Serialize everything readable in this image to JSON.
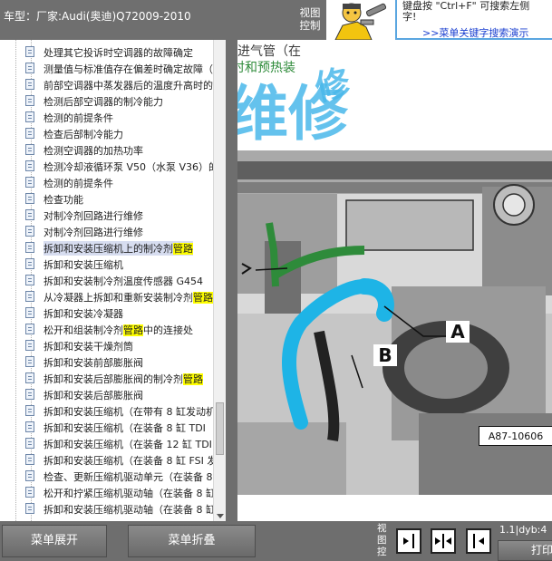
{
  "title_bar": {
    "title": "车型：厂家:Audi(奥迪)Q72009-2010",
    "view_control": "视图控制"
  },
  "banner": {
    "tip_line1": "键盘按 \"Ctrl+F\" 可搜索左侧",
    "tip_line2": "字!",
    "tip_link": ">>菜单关键字搜索演示"
  },
  "tree": {
    "items": [
      {
        "label": "处理其它投诉时空调器的故障确定"
      },
      {
        "label": "测量值与标准值存在偏差时确定故障（"
      },
      {
        "label": "前部空调器中蒸发器后的温度升高时的"
      },
      {
        "label": "检测后部空调器的制冷能力"
      },
      {
        "label": "检测的前提条件"
      },
      {
        "label": "检查后部制冷能力"
      },
      {
        "label": "检测空调器的加热功率"
      },
      {
        "label": "检测冷却液循环泵 V50（水泵 V36）的"
      },
      {
        "label": "检测的前提条件"
      },
      {
        "label": "检查功能"
      },
      {
        "label": "对制冷剂回路进行维修"
      },
      {
        "label": "对制冷剂回路进行维修"
      },
      {
        "label": "拆卸和安装压缩机上的制冷剂",
        "highlight": "管路",
        "selected": true
      },
      {
        "label": "拆卸和安装压缩机"
      },
      {
        "label": "拆卸和安装制冷剂温度传感器 G454"
      },
      {
        "label": "从冷凝器上拆卸和重新安装制冷剂",
        "highlight": "管路"
      },
      {
        "label": "拆卸和安装冷凝器"
      },
      {
        "label": "松开和组装制冷剂",
        "highlight": "管路",
        "suffix": "中的连接处"
      },
      {
        "label": "拆卸和安装干燥剂筒"
      },
      {
        "label": "拆卸和安装前部膨胀阀"
      },
      {
        "label": "拆卸和安装后部膨胀阀的制冷剂",
        "highlight": "管路"
      },
      {
        "label": "拆卸和安装后部膨胀阀"
      },
      {
        "label": "拆卸和安装压缩机（在带有 8 缸发动机"
      },
      {
        "label": "拆卸和安装压缩机（在装备 8 缸 TDI"
      },
      {
        "label": "拆卸和安装压缩机（在装备 12 缸 TDI"
      },
      {
        "label": "拆卸和安装压缩机（在装备 8 缸 FSI 发"
      },
      {
        "label": "检查、更新压缩机驱动单元（在装备 8"
      },
      {
        "label": "松开和拧紧压缩机驱动轴（在装备 8 缸"
      },
      {
        "label": "拆卸和安装压缩机驱动轴（在装备 8 缸"
      }
    ]
  },
  "image_pane": {
    "caption_line1": "进气管（在",
    "caption_line2": "时和预热装",
    "callout_a": "A",
    "callout_b": "B",
    "figure_id": "A87-10606"
  },
  "bottom_bar": {
    "expand_label": "菜单展开",
    "collapse_label": "菜单折叠",
    "view_control": "视图控",
    "status": "1.1|dyb:4",
    "print_label": "打印"
  },
  "colors": {
    "chrome_gray": "#6e6e6e",
    "highlight_yellow": "#ffff00",
    "selection_blue": "#d7ddf0",
    "pipe_cyan": "#1eb4e6",
    "pipe_green": "#2e8b3a",
    "link_blue": "#1a3fd0"
  }
}
